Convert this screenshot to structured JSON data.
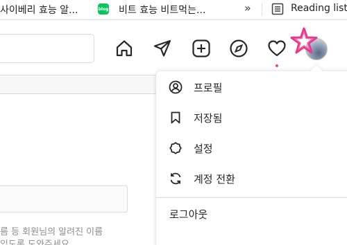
{
  "bookmarks": {
    "item1_label": "사이베리 효능 알...",
    "item2_icon_text": "blog",
    "item2_label": "비트 효능 비트먹는...",
    "overflow_chevron": "»",
    "reading_list_label": "Reading list"
  },
  "header": {
    "search_placeholder": "",
    "nav_icons": [
      "home-icon",
      "direct-message-icon",
      "new-post-icon",
      "explore-icon",
      "activity-heart-icon"
    ],
    "notification_dot_color": "#ed4956",
    "avatar": "profile-avatar"
  },
  "background": {
    "help_line1": "름 등 회원님의 알려진 이름",
    "help_line2": "있도록 도와주세요."
  },
  "menu": {
    "items": [
      {
        "label": "프로필",
        "icon": "profile-icon"
      },
      {
        "label": "저장됨",
        "icon": "bookmark-icon"
      },
      {
        "label": "설정",
        "icon": "settings-icon"
      },
      {
        "label": "계정 전환",
        "icon": "switch-account-icon"
      }
    ],
    "logout_label": "로그아웃"
  },
  "colors": {
    "text": "#262626",
    "border": "#dbdbdb",
    "accent_star": "#e8388a"
  }
}
